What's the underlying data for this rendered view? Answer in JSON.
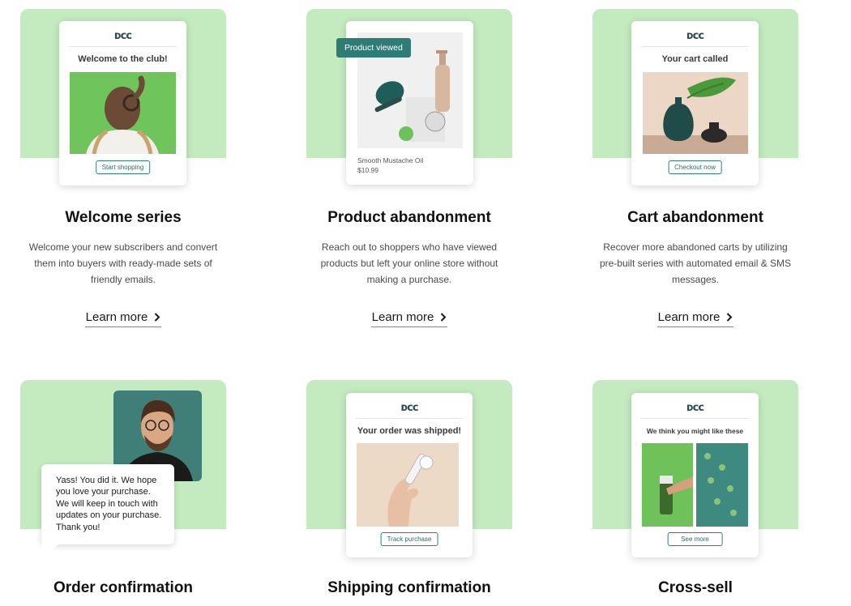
{
  "cards": [
    {
      "title": "Welcome series",
      "description": "Welcome your new subscribers and convert them into buyers with ready-made sets of friendly emails.",
      "learn_more": "Learn more",
      "email": {
        "logo": "ᴅᴄᴄ",
        "heading": "Welcome to the club!",
        "button": "Start shopping"
      }
    },
    {
      "title": "Product abandonment",
      "description": "Reach out to shoppers who have viewed products but left your online store without making a purchase.",
      "learn_more": "Learn more",
      "email": {
        "tag": "Product viewed",
        "product_name": "Smooth Mustache Oil",
        "price": "$10.99"
      }
    },
    {
      "title": "Cart abandonment",
      "description": "Recover more abandoned carts by utilizing pre-built series with automated email & SMS messages.",
      "learn_more": "Learn more",
      "email": {
        "logo": "ᴅᴄᴄ",
        "heading": "Your cart called",
        "button": "Checkout now"
      }
    },
    {
      "title": "Order confirmation",
      "email": {
        "message": "Yass! You did it. We hope you love your purchase. We will keep in touch with updates on your purchase. Thank you!"
      }
    },
    {
      "title": "Shipping confirmation",
      "email": {
        "logo": "ᴅᴄᴄ",
        "heading": "Your order was shipped!",
        "button": "Track purchase"
      }
    },
    {
      "title": "Cross-sell",
      "email": {
        "logo": "ᴅᴄᴄ",
        "heading": "We think you might like these",
        "button": "See more"
      }
    }
  ],
  "colors": {
    "panel_green": "#c4eabf",
    "teal": "#2e7c76",
    "underline_green": "#38b26a"
  },
  "icons": [
    "chevron-right-icon",
    "speech-bubble-icon"
  ]
}
